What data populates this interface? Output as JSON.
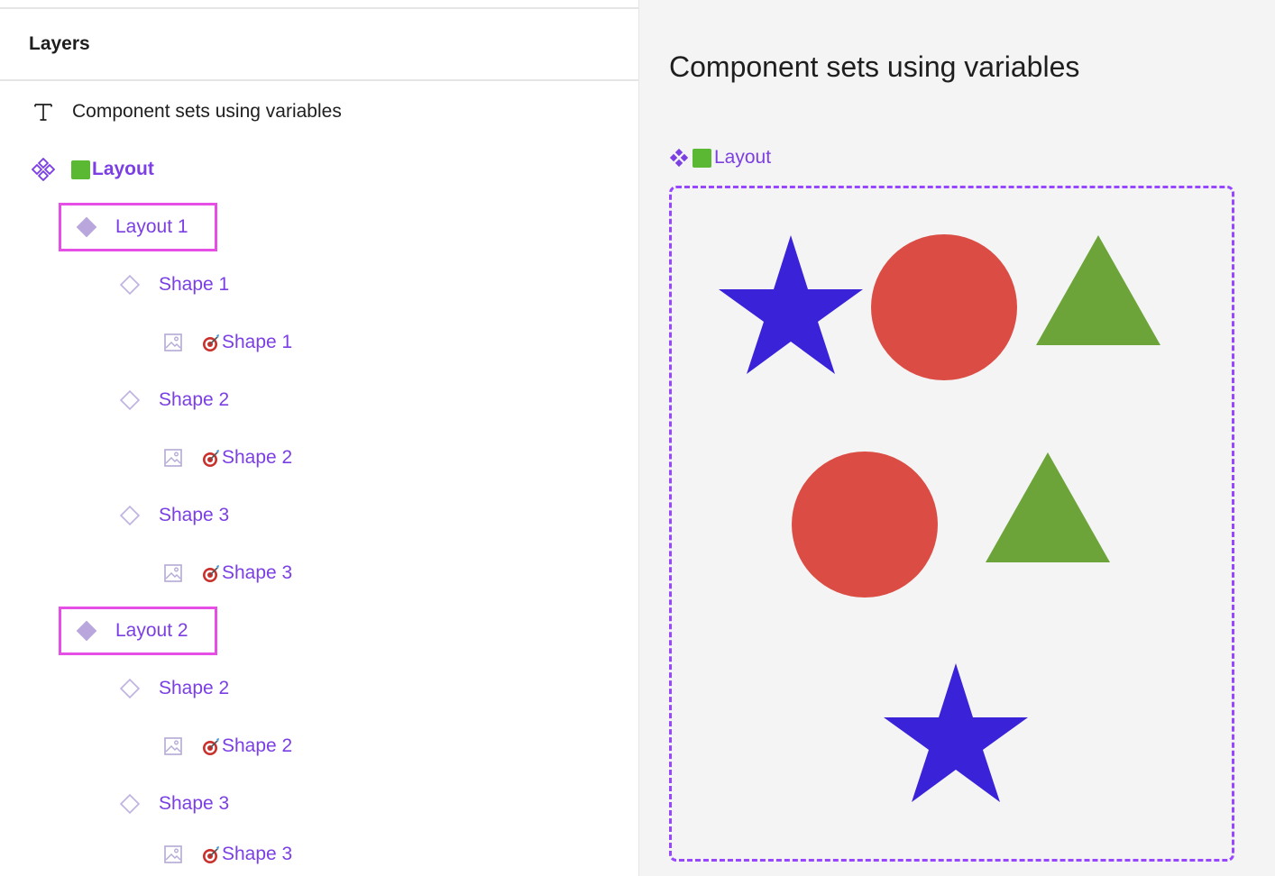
{
  "layers_panel": {
    "title": "Layers",
    "items": [
      {
        "label": "Component sets using variables",
        "icon": "text-icon"
      },
      {
        "label": "Layout",
        "icon": "component-set-icon",
        "emoji": "green-square-icon"
      },
      {
        "label": "Layout 1",
        "icon": "component-icon",
        "highlighted": true
      },
      {
        "label": "Shape 1",
        "icon": "instance-icon"
      },
      {
        "label": "Shape 1",
        "icon": "image-icon",
        "emoji": "target-icon"
      },
      {
        "label": "Shape 2",
        "icon": "instance-icon"
      },
      {
        "label": "Shape 2",
        "icon": "image-icon",
        "emoji": "target-icon"
      },
      {
        "label": "Shape 3",
        "icon": "instance-icon"
      },
      {
        "label": "Shape 3",
        "icon": "image-icon",
        "emoji": "target-icon"
      },
      {
        "label": "Layout 2",
        "icon": "component-icon",
        "highlighted": true
      },
      {
        "label": "Shape 2",
        "icon": "instance-icon"
      },
      {
        "label": "Shape 2",
        "icon": "image-icon",
        "emoji": "target-icon"
      },
      {
        "label": "Shape 3",
        "icon": "instance-icon"
      },
      {
        "label": "Shape 3",
        "icon": "image-icon",
        "emoji": "target-icon"
      }
    ]
  },
  "canvas": {
    "title": "Component sets using variables",
    "frame_label": "Layout",
    "layout_1_shapes": [
      "star-shape",
      "circle-shape",
      "triangle-shape"
    ],
    "layout_2_shapes": [
      "circle-shape",
      "triangle-shape",
      "star-shape"
    ]
  },
  "colors": {
    "accent": "#7b3fe4",
    "component_border": "#9747ff",
    "highlight": "#e64fe6",
    "star": "#3a22d8",
    "circle": "#db4c44",
    "triangle": "#6ca43a",
    "emoji_green": "#5bb832"
  }
}
